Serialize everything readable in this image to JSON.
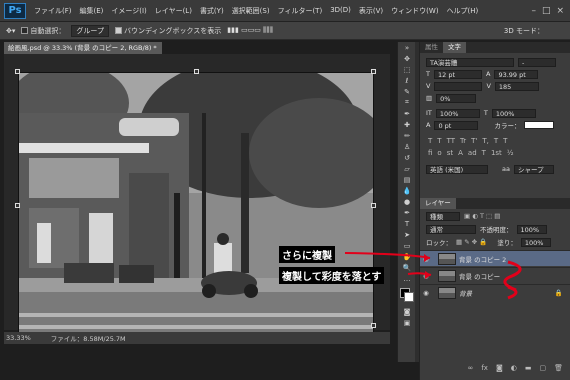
{
  "app": {
    "logo": "Ps"
  },
  "menu": [
    "ファイル(F)",
    "編集(E)",
    "イメージ(I)",
    "レイヤー(L)",
    "書式(Y)",
    "選択範囲(S)",
    "フィルター(T)",
    "3D(D)",
    "表示(V)",
    "ウィンドウ(W)",
    "ヘルプ(H)"
  ],
  "window_controls": [
    "–",
    "□",
    "×"
  ],
  "options": {
    "auto_select": "自動選択：",
    "group_value": "グループ",
    "bbox": "バウンディングボックスを表示",
    "three_d": "3D モード："
  },
  "document": {
    "tab_title": "絵画風.psd @ 33.3% (背景 のコピー 2, RGB/8) *",
    "zoom": "33.33%",
    "file_info": "ファイル：8.58M/25.7M"
  },
  "character_panel": {
    "tabs": [
      "属性",
      "文字"
    ],
    "font_name": "TA演芸體",
    "font_size": "12 pt",
    "leading": "93.99 pt",
    "tracking": "185",
    "percent": "0%",
    "vscale": "100%",
    "hscale": "100%",
    "baseline": "0 pt",
    "color_label": "カラー：",
    "glyph_row1": [
      "T",
      "T",
      "TT",
      "Tr",
      "T'",
      "T,",
      "T",
      "T"
    ],
    "glyph_row2": [
      "fi",
      "o",
      "st",
      "A",
      "ad",
      "T",
      "1st",
      "½"
    ],
    "language": "英語 (米国)",
    "aa_label": "aa",
    "aa_value": "シャープ"
  },
  "layers_panel": {
    "tab": "レイヤー",
    "kind": "種類",
    "blend_mode": "通常",
    "opacity_label": "不透明度：",
    "opacity": "100%",
    "lock_label": "ロック：",
    "fill_label": "塗り：",
    "fill": "100%",
    "layers": [
      {
        "name": "背景 のコピー 2",
        "selected": true
      },
      {
        "name": "背景 のコピー",
        "selected": false
      },
      {
        "name": "背景",
        "selected": false,
        "locked": true
      }
    ],
    "footer_icons": [
      "link-icon",
      "fx-icon",
      "mask-icon",
      "adjust-icon",
      "folder-icon",
      "new-layer-icon",
      "trash-icon"
    ]
  },
  "annotations": {
    "note1": "さらに複製",
    "note2": "複製して彩度を落とす"
  },
  "colors": {
    "selected_layer": "#5a6a86",
    "annotation_arrow": "#e2001a",
    "ps_blue": "#41a8f4"
  }
}
